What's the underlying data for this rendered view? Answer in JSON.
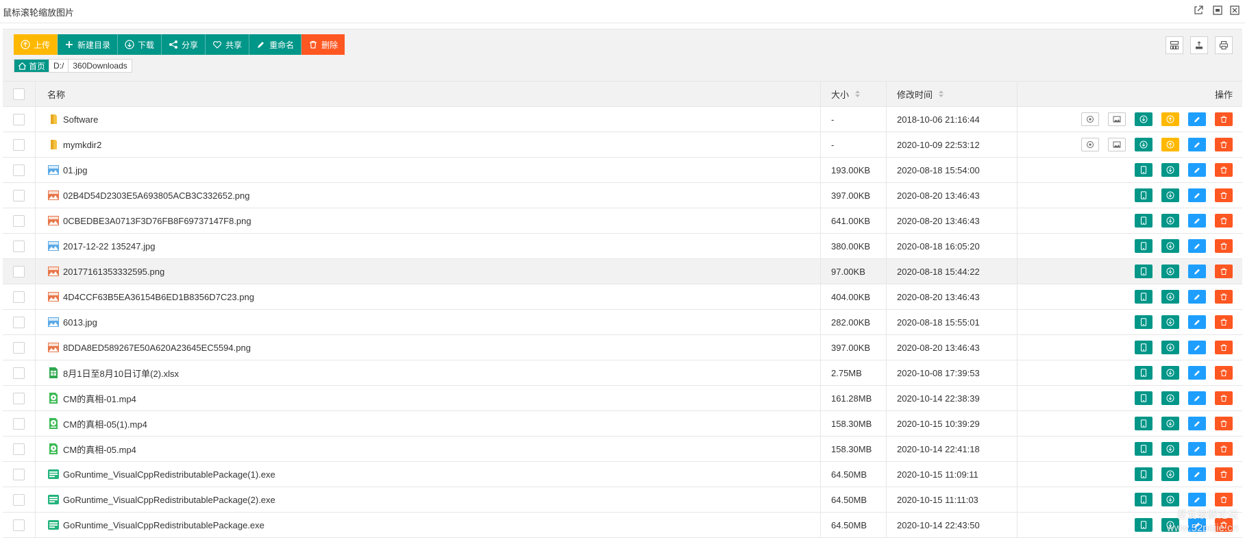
{
  "window": {
    "title": "鼠标滚轮缩放图片"
  },
  "toolbar": {
    "upload": "上传",
    "new_dir": "新建目录",
    "download": "下载",
    "share": "分享",
    "public_share": "共享",
    "rename": "重命名",
    "delete": "删除"
  },
  "breadcrumb": {
    "home": "首页",
    "drive": "D:/",
    "folder": "360Downloads"
  },
  "table": {
    "headers": {
      "name": "名称",
      "size": "大小",
      "mtime": "修改时间",
      "ops": "操作"
    },
    "rows": [
      {
        "name": "Software",
        "size": "-",
        "mtime": "2018-10-06 21:16:44",
        "type": "folder"
      },
      {
        "name": "mymkdir2",
        "size": "-",
        "mtime": "2020-10-09 22:53:12",
        "type": "folder"
      },
      {
        "name": "01.jpg",
        "size": "193.00KB",
        "mtime": "2020-08-18 15:54:00",
        "type": "jpg"
      },
      {
        "name": "02B4D54D2303E5A693805ACB3C332652.png",
        "size": "397.00KB",
        "mtime": "2020-08-20 13:46:43",
        "type": "png"
      },
      {
        "name": "0CBEDBE3A0713F3D76FB8F69737147F8.png",
        "size": "641.00KB",
        "mtime": "2020-08-20 13:46:43",
        "type": "png"
      },
      {
        "name": "2017-12-22 135247.jpg",
        "size": "380.00KB",
        "mtime": "2020-08-18 16:05:20",
        "type": "jpg"
      },
      {
        "name": "20177161353332595.png",
        "size": "97.00KB",
        "mtime": "2020-08-18 15:44:22",
        "type": "png"
      },
      {
        "name": "4D4CCF63B5EA36154B6ED1B8356D7C23.png",
        "size": "404.00KB",
        "mtime": "2020-08-20 13:46:43",
        "type": "png"
      },
      {
        "name": "6013.jpg",
        "size": "282.00KB",
        "mtime": "2020-08-18 15:55:01",
        "type": "jpg"
      },
      {
        "name": "8DDA8ED589267E50A620A23645EC5594.png",
        "size": "397.00KB",
        "mtime": "2020-08-20 13:46:43",
        "type": "png"
      },
      {
        "name": "8月1日至8月10日订单(2).xlsx",
        "size": "2.75MB",
        "mtime": "2020-10-08 17:39:53",
        "type": "xlsx"
      },
      {
        "name": "CM的真相-01.mp4",
        "size": "161.28MB",
        "mtime": "2020-10-14 22:38:39",
        "type": "mp4"
      },
      {
        "name": "CM的真相-05(1).mp4",
        "size": "158.30MB",
        "mtime": "2020-10-15 10:39:29",
        "type": "mp4"
      },
      {
        "name": "CM的真相-05.mp4",
        "size": "158.30MB",
        "mtime": "2020-10-14 22:41:18",
        "type": "mp4"
      },
      {
        "name": "GoRuntime_VisualCppRedistributablePackage(1).exe",
        "size": "64.50MB",
        "mtime": "2020-10-15 11:09:11",
        "type": "exe"
      },
      {
        "name": "GoRuntime_VisualCppRedistributablePackage(2).exe",
        "size": "64.50MB",
        "mtime": "2020-10-15 11:11:03",
        "type": "exe"
      },
      {
        "name": "GoRuntime_VisualCppRedistributablePackage.exe",
        "size": "64.50MB",
        "mtime": "2020-10-14 22:43:50",
        "type": "exe"
      }
    ]
  },
  "watermark": {
    "line1": "吾爱破解论坛",
    "line2": "www.52pojie.cn"
  },
  "colors": {
    "green": "#009688",
    "yellow": "#ffb800",
    "red": "#ff5722",
    "blue": "#1e9fff"
  }
}
